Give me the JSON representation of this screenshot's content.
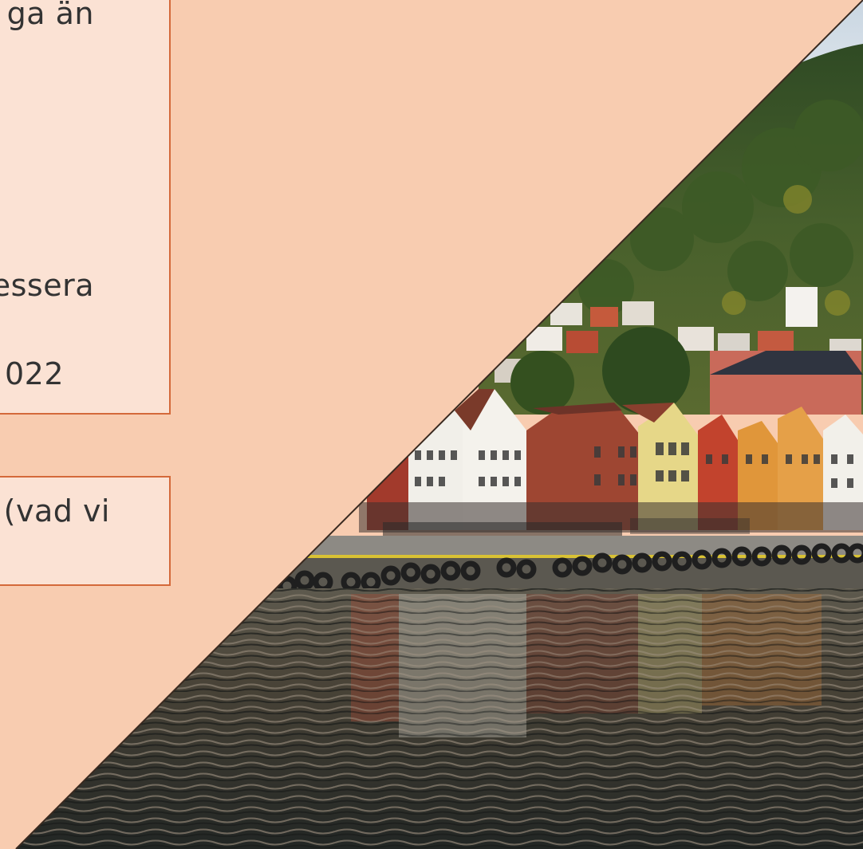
{
  "slide": {
    "box1": {
      "line1": "ga än",
      "line2": "essera",
      "line3": "022"
    },
    "box2": {
      "line1": "(vad vi"
    }
  },
  "colors": {
    "background": "#f8ccb0",
    "box_fill": "#fbe2d4",
    "box_border": "#d4693a",
    "text": "#333333"
  },
  "photo": {
    "subject": "harbor-waterfront-photo"
  }
}
